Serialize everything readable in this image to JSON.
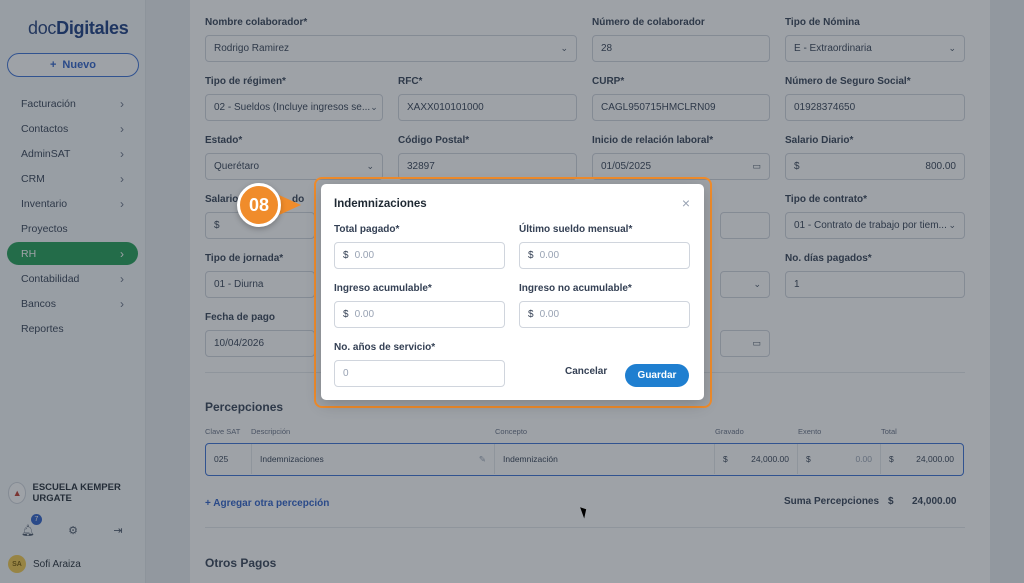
{
  "sidebar": {
    "logo_prefix": "doc",
    "logo_bold": "Digitales",
    "new_button": "Nuevo",
    "items": [
      {
        "label": "Facturación",
        "chevron": true
      },
      {
        "label": "Contactos",
        "chevron": true
      },
      {
        "label": "AdminSAT",
        "chevron": true
      },
      {
        "label": "CRM",
        "chevron": true
      },
      {
        "label": "Inventario",
        "chevron": true
      },
      {
        "label": "Proyectos",
        "chevron": false
      },
      {
        "label": "RH",
        "chevron": true,
        "active": true
      },
      {
        "label": "Contabilidad",
        "chevron": true
      },
      {
        "label": "Bancos",
        "chevron": true
      },
      {
        "label": "Reportes",
        "chevron": false
      }
    ],
    "org_name": "ESCUELA KEMPER URGATE",
    "notifications": "7",
    "user_initials": "SA",
    "user_name": "Sofi Araiza"
  },
  "form": {
    "nombre": {
      "label": "Nombre colaborador*",
      "value": "Rodrigo Ramirez"
    },
    "numero": {
      "label": "Número de colaborador",
      "value": "28"
    },
    "tipo_nomina": {
      "label": "Tipo de Nómina",
      "value": "E - Extraordinaria"
    },
    "regimen": {
      "label": "Tipo de régimen*",
      "value": "02 - Sueldos (Incluye ingresos se..."
    },
    "rfc": {
      "label": "RFC*",
      "value": "XAXX010101000"
    },
    "curp": {
      "label": "CURP*",
      "value": "CAGL950715HMCLRN09"
    },
    "nss": {
      "label": "Número de Seguro Social*",
      "value": "01928374650"
    },
    "estado": {
      "label": "Estado*",
      "value": "Querétaro"
    },
    "cp": {
      "label": "Código Postal*",
      "value": "32897"
    },
    "inicio": {
      "label": "Inicio de relación laboral*",
      "value": "01/05/2025"
    },
    "salario_diario": {
      "label": "Salario Diario*",
      "currency": "$",
      "value": "800.00"
    },
    "salario_partial_label": "Salario",
    "salario_partial_tail": "do",
    "salario_partial_cur": "$",
    "tipo_contrato": {
      "label": "Tipo de contrato*",
      "value": "01 - Contrato de trabajo por tiem..."
    },
    "jornada": {
      "label": "Tipo de jornada*",
      "value": "01 - Diurna"
    },
    "dias": {
      "label": "No. días pagados*",
      "value": "1"
    },
    "fecha_pago": {
      "label": "Fecha de pago",
      "value": "10/04/2026"
    }
  },
  "percepciones": {
    "title": "Percepciones",
    "headers": [
      "Clave SAT",
      "Descripción",
      "Concepto",
      "Gravado",
      "Exento",
      "Total"
    ],
    "row": {
      "clave": "025",
      "descripcion": "Indemnizaciones",
      "concepto": "Indemnización",
      "gravado_cur": "$",
      "gravado": "24,000.00",
      "exento_cur": "$",
      "exento": "0.00",
      "total_cur": "$",
      "total": "24,000.00"
    },
    "add_link": "+ Agregar otra percepción",
    "sum_label": "Suma Percepciones",
    "sum_cur": "$",
    "sum_value": "24,000.00"
  },
  "otros_pagos": "Otros Pagos",
  "modal": {
    "title": "Indemnizaciones",
    "close": "×",
    "total_pagado": {
      "label": "Total pagado*",
      "currency": "$",
      "placeholder": "0.00"
    },
    "ultimo_sueldo": {
      "label": "Último sueldo mensual*",
      "currency": "$",
      "placeholder": "0.00"
    },
    "ingreso_acum": {
      "label": "Ingreso acumulable*",
      "currency": "$",
      "placeholder": "0.00"
    },
    "ingreso_no_acum": {
      "label": "Ingreso no acumulable*",
      "currency": "$",
      "placeholder": "0.00"
    },
    "anios": {
      "label": "No. años de servicio*",
      "placeholder": "0"
    },
    "cancel": "Cancelar",
    "save": "Guardar"
  },
  "step_badge": "08",
  "colors": {
    "accent": "#1f7fd0",
    "highlight": "#f08c2b",
    "active_nav": "#1f9d55"
  }
}
